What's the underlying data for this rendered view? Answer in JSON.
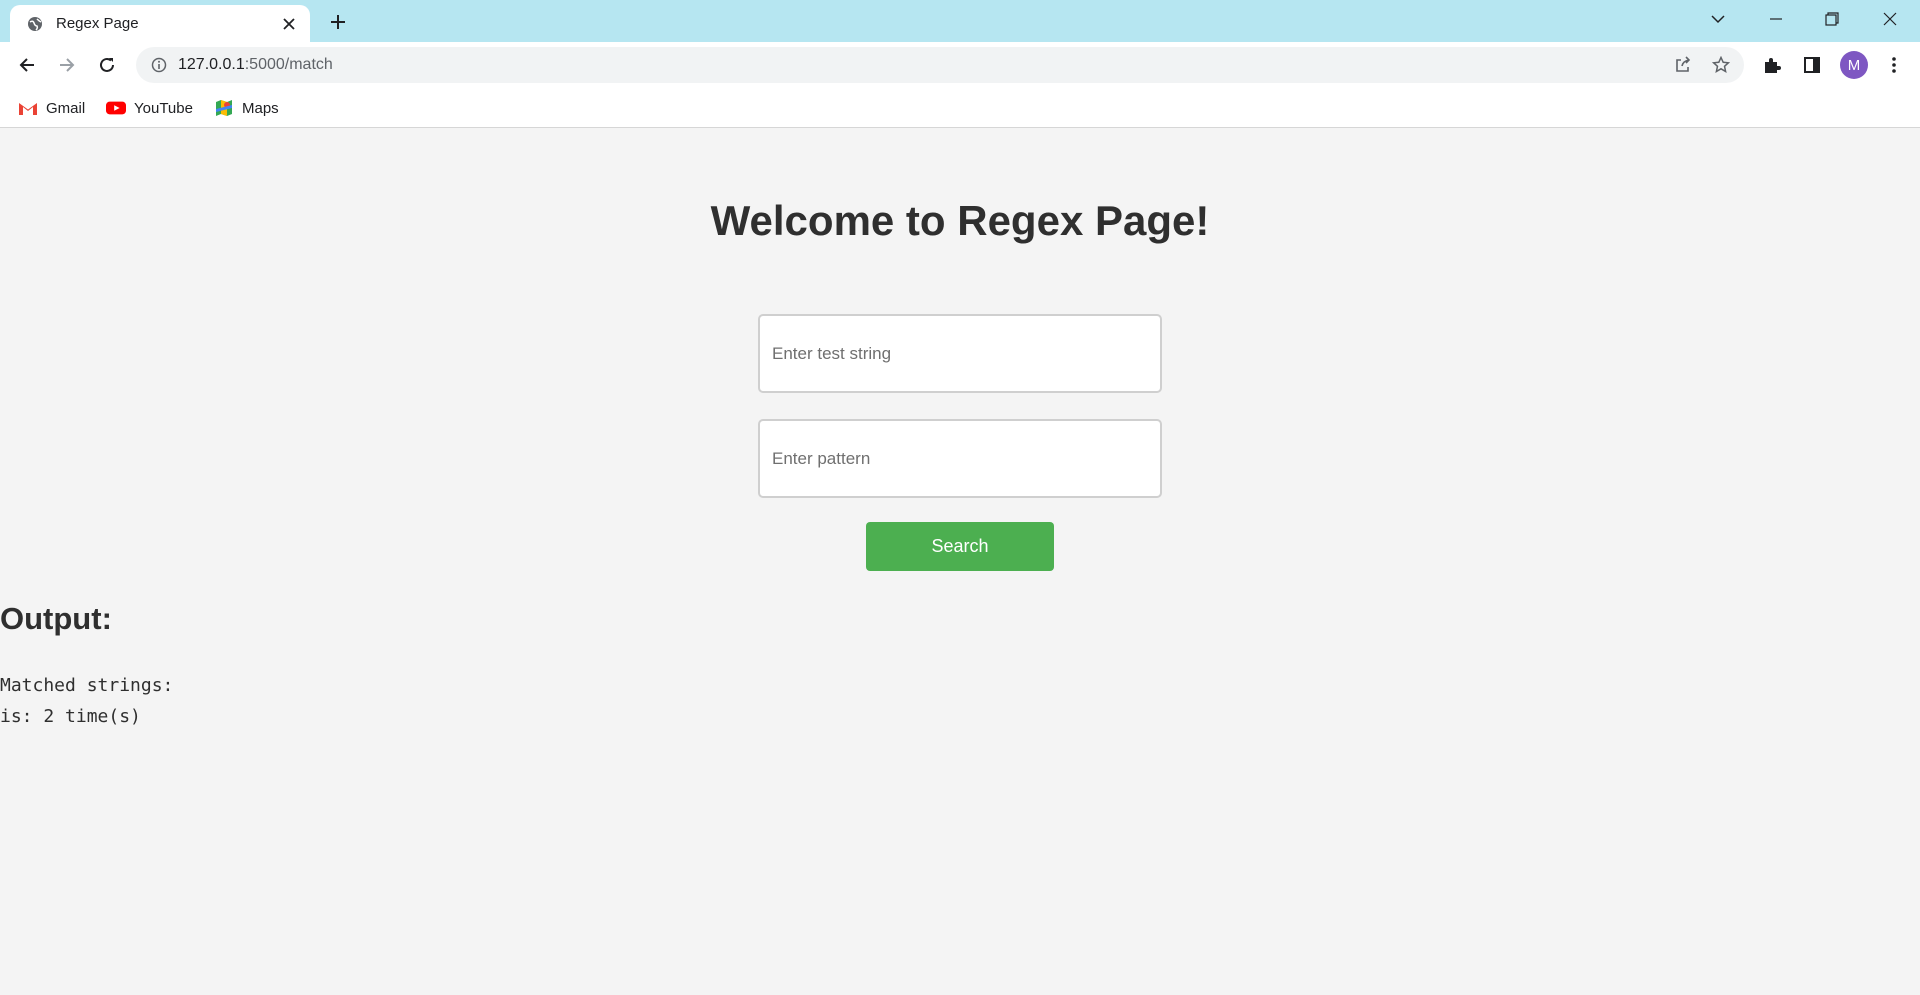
{
  "browser": {
    "tab_title": "Regex Page",
    "url_host": "127.0.0.1",
    "url_path": ":5000/match",
    "bookmarks": [
      "Gmail",
      "YouTube",
      "Maps"
    ],
    "profile_initial": "M",
    "accent_colors": {
      "tabstrip": "#b6e6f1",
      "avatar": "#7e57c2",
      "youtube": "#ff0000",
      "gmail": "#ea4335"
    }
  },
  "page": {
    "heading": "Welcome to Regex Page!",
    "test_string_placeholder": "Enter test string",
    "pattern_placeholder": "Enter pattern",
    "search_label": "Search",
    "output_heading": "Output:",
    "output_lines": [
      "Matched strings:",
      "is: 2 time(s)"
    ],
    "button_color": "#4caf50"
  }
}
